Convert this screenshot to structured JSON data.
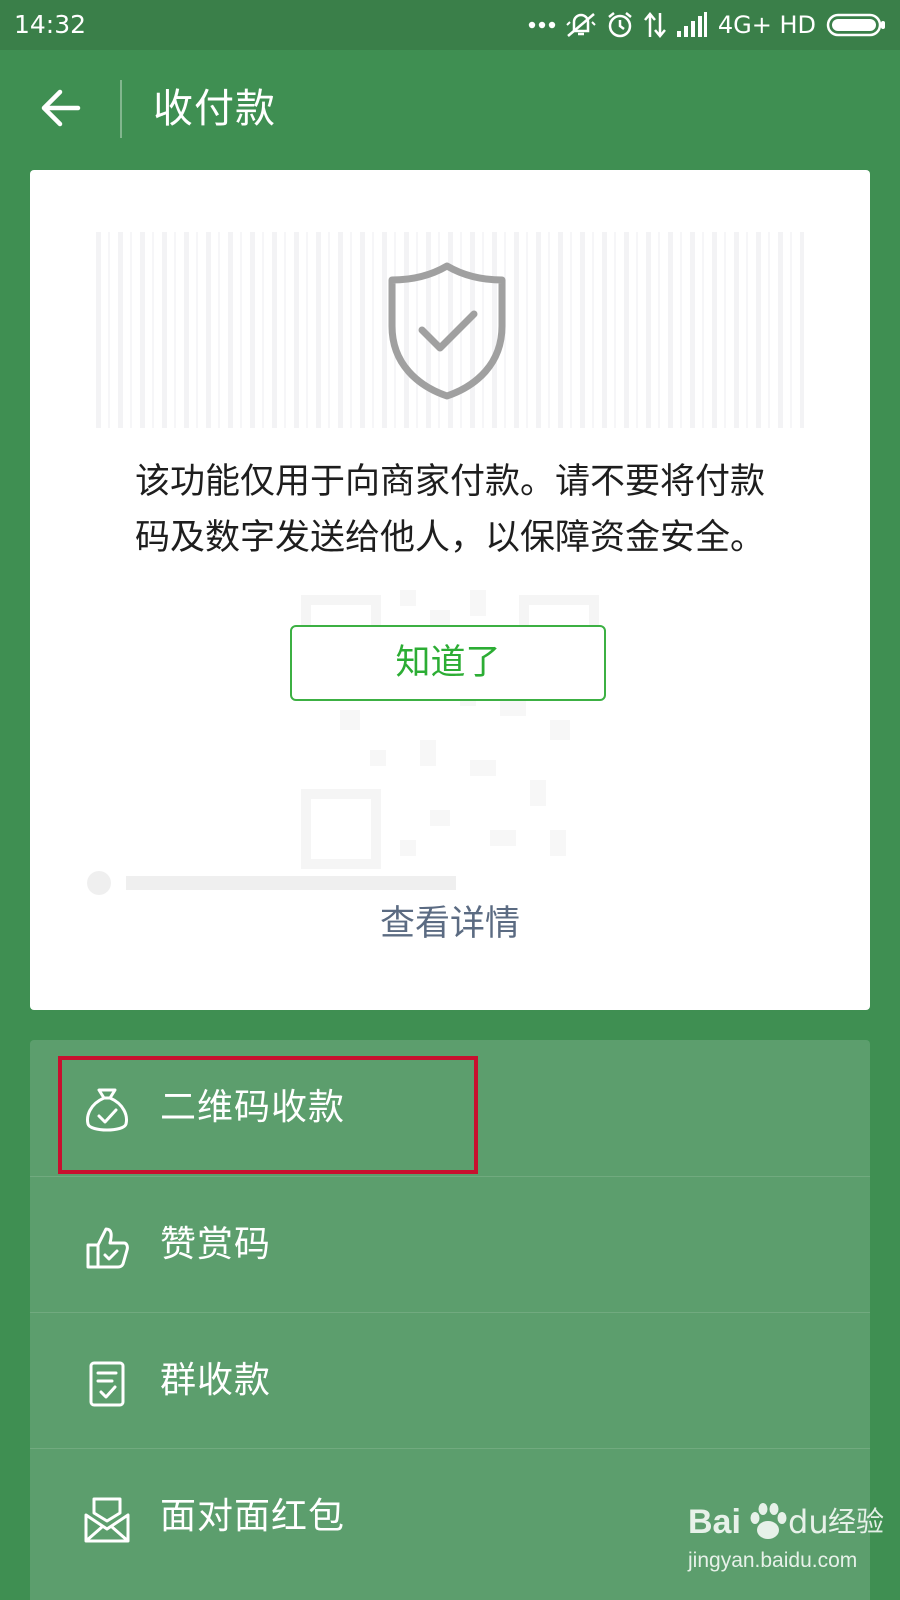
{
  "status_bar": {
    "time": "14:32",
    "network": "4G+ HD",
    "icons": [
      "more-dots-icon",
      "mute-vibrate-icon",
      "alarm-icon",
      "data-transfer-icon",
      "signal-icon",
      "battery-icon"
    ]
  },
  "header": {
    "title": "收付款",
    "back_icon": "arrow-left-icon"
  },
  "notice_card": {
    "icon": "shield-check-icon",
    "message_line1": "该功能仅用于向商家付款。请不要将付款",
    "message_line2": "码及数字发送给他人，以保障资金安全。",
    "ok_button": "知道了",
    "details_link": "查看详情"
  },
  "menu": {
    "items": [
      {
        "label": "二维码收款",
        "icon": "money-bag-icon"
      },
      {
        "label": "赞赏码",
        "icon": "thumbs-up-icon"
      },
      {
        "label": "群收款",
        "icon": "receipt-icon"
      },
      {
        "label": "面对面红包",
        "icon": "red-envelope-icon"
      }
    ]
  },
  "annotation": {
    "highlight_color": "#c8102e"
  },
  "watermark": {
    "brand_b": "Bai",
    "brand_d": "du",
    "brand_cn": "经验",
    "url": "jingyan.baidu.com"
  },
  "colors": {
    "status_bar": "#3a7f49",
    "primary_green": "#3f8f52",
    "menu_panel": "#5c9e6d",
    "button_green": "#2cad34",
    "link_text": "#5b6b82"
  }
}
